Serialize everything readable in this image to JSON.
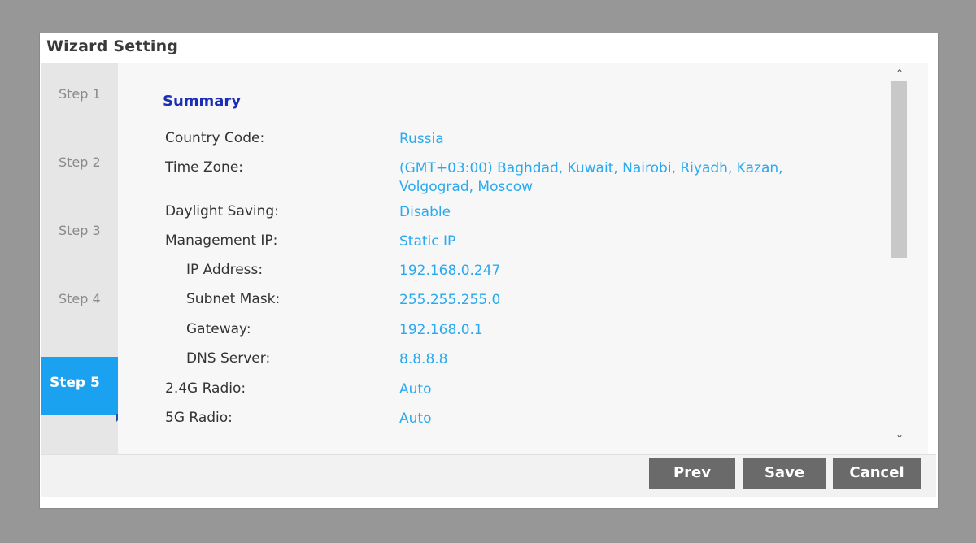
{
  "dialog": {
    "title": "Wizard Setting"
  },
  "steps": [
    "Step 1",
    "Step 2",
    "Step 3",
    "Step 4",
    "Step 5"
  ],
  "active_step": "Step 5",
  "summary": {
    "title": "Summary",
    "rows": [
      {
        "label": "Country Code:",
        "value": "Russia"
      },
      {
        "label": "Time Zone:",
        "value": "(GMT+03:00) Baghdad, Kuwait, Nairobi, Riyadh, Kazan, Volgograd, Moscow"
      },
      {
        "label": "Daylight Saving:",
        "value": "Disable"
      },
      {
        "label": "Management IP:",
        "value": "Static IP"
      },
      {
        "label": "IP Address:",
        "value": "192.168.0.247"
      },
      {
        "label": "Subnet Mask:",
        "value": "255.255.255.0"
      },
      {
        "label": "Gateway:",
        "value": "192.168.0.1"
      },
      {
        "label": "DNS Server:",
        "value": "8.8.8.8"
      },
      {
        "label": "2.4G Radio:",
        "value": "Auto"
      },
      {
        "label": "5G Radio:",
        "value": "Auto"
      }
    ]
  },
  "buttons": {
    "prev": "Prev",
    "save": "Save",
    "cancel": "Cancel"
  },
  "colors": {
    "accent": "#1aa1f0",
    "value_text": "#29aaf0",
    "summary_title": "#1a2fb5",
    "button_bg": "#6a6a6a"
  },
  "icons": {
    "scroll_up": "chevron-up-icon",
    "scroll_down": "chevron-down-icon"
  }
}
